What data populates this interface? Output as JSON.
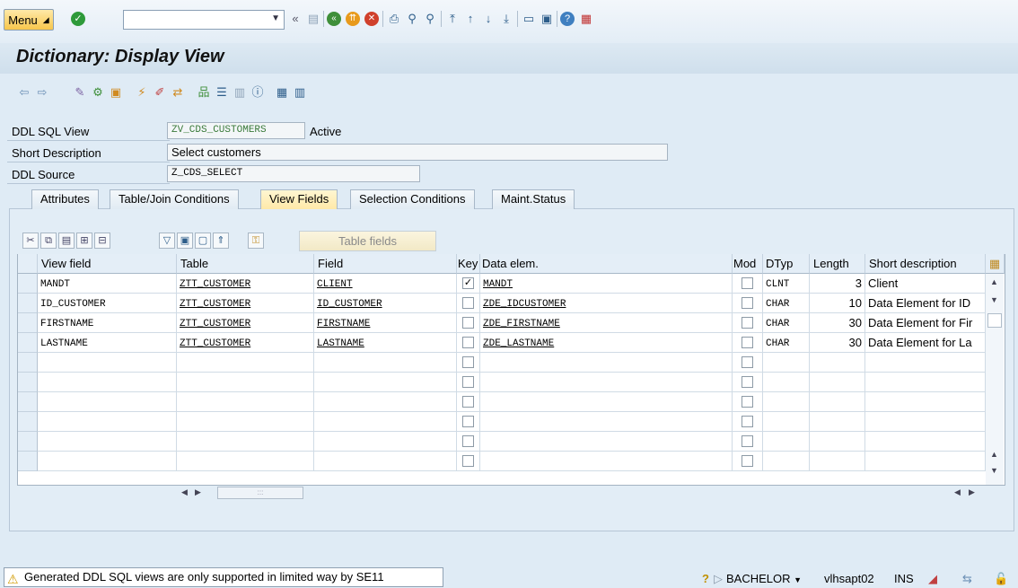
{
  "toolbar": {
    "menu_label": "Menu",
    "command_value": ""
  },
  "title": "Dictionary: Display View",
  "form": {
    "ddl_sql_view_label": "DDL SQL View",
    "ddl_sql_view_value": "ZV_CDS_CUSTOMERS",
    "status": "Active",
    "short_description_label": "Short Description",
    "short_description_value": "Select customers",
    "ddl_source_label": "DDL Source",
    "ddl_source_value": "Z_CDS_SELECT"
  },
  "tabs": [
    "Attributes",
    "Table/Join Conditions",
    "View Fields",
    "Selection Conditions",
    "Maint.Status"
  ],
  "active_tab": "View Fields",
  "grid_toolbar": {
    "table_fields_label": "Table fields"
  },
  "grid": {
    "headers": [
      "View field",
      "Table",
      "Field",
      "Key",
      "Data elem.",
      "Mod",
      "DTyp",
      "Length",
      "Short description"
    ],
    "rows": [
      {
        "view_field": "MANDT",
        "table": "ZTT_CUSTOMER",
        "field": "CLIENT",
        "key": true,
        "data_elem": "MANDT",
        "mod": false,
        "dtyp": "CLNT",
        "length": "3",
        "short_description": "Client"
      },
      {
        "view_field": "ID_CUSTOMER",
        "table": "ZTT_CUSTOMER",
        "field": "ID_CUSTOMER",
        "key": false,
        "data_elem": "ZDE_IDCUSTOMER",
        "mod": false,
        "dtyp": "CHAR",
        "length": "10",
        "short_description": "Data Element for ID"
      },
      {
        "view_field": "FIRSTNAME",
        "table": "ZTT_CUSTOMER",
        "field": "FIRSTNAME",
        "key": false,
        "data_elem": "ZDE_FIRSTNAME",
        "mod": false,
        "dtyp": "CHAR",
        "length": "30",
        "short_description": "Data Element for Fir"
      },
      {
        "view_field": "LASTNAME",
        "table": "ZTT_CUSTOMER",
        "field": "LASTNAME",
        "key": false,
        "data_elem": "ZDE_LASTNAME",
        "mod": false,
        "dtyp": "CHAR",
        "length": "30",
        "short_description": "Data Element for La"
      }
    ],
    "empty_rows": 6
  },
  "status_bar": {
    "message": "Generated DDL SQL views are only supported in limited way by SE11",
    "system": "BACHELOR",
    "host": "vlhsapt02",
    "mode": "INS"
  },
  "colors": {
    "accent": "#f7c64c",
    "background": "#dfebf5",
    "grid_header": "#e4eef7"
  }
}
